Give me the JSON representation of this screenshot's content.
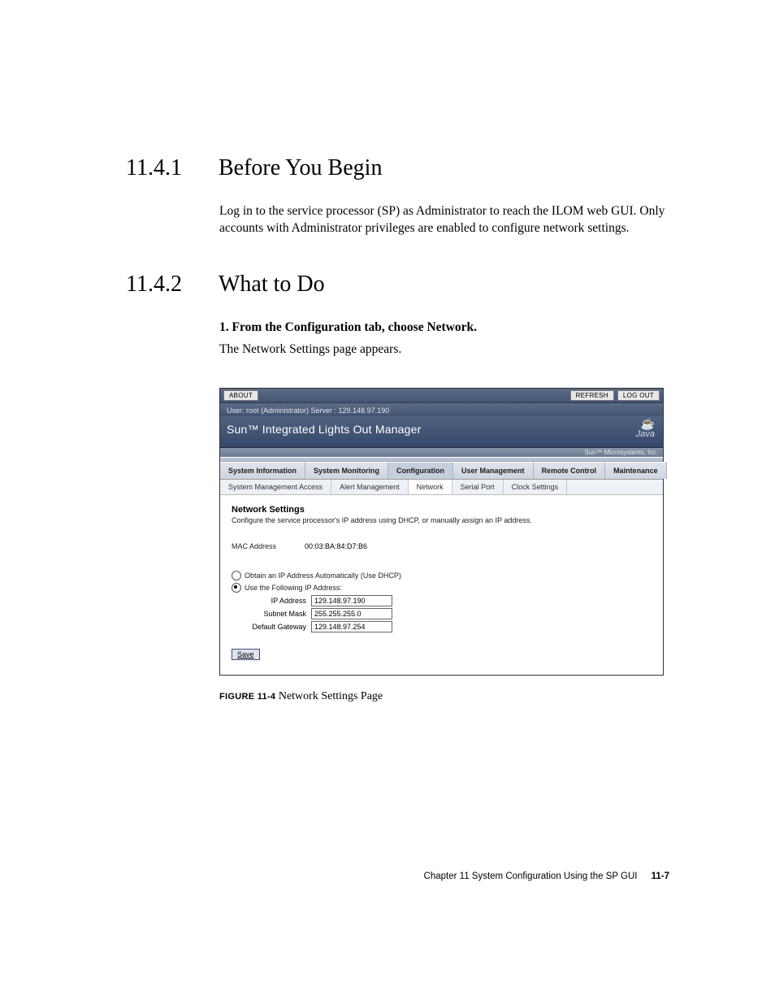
{
  "section1": {
    "num": "11.4.1",
    "title": "Before You Begin"
  },
  "para1": "Log in to the service processor (SP) as Administrator to reach the ILOM web GUI. Only accounts with Administrator privileges are enabled to configure network settings.",
  "section2": {
    "num": "11.4.2",
    "title": "What to Do"
  },
  "step1_bold": "1. From the Configuration tab, choose Network.",
  "step1_text": "The Network Settings page appears.",
  "screenshot": {
    "about": "ABOUT",
    "refresh": "REFRESH",
    "logout": "LOG OUT",
    "userline": "User: root (Administrator)   Server : 129.148.97.190",
    "title": "Sun™ Integrated Lights Out Manager",
    "java": "Java",
    "attribution": "Sun™ Microsystems, Inc.",
    "tabs": [
      "System Information",
      "System Monitoring",
      "Configuration",
      "User Management",
      "Remote Control",
      "Maintenance"
    ],
    "subtabs": [
      "System Management Access",
      "Alert Management",
      "Network",
      "Serial Port",
      "Clock Settings"
    ],
    "panel_title": "Network Settings",
    "panel_sub": "Configure the service processor's IP address using DHCP, or manually assign an IP address.",
    "mac_label": "MAC Address",
    "mac_value": "00:03:BA:84:D7:B6",
    "radio_dhcp": "Obtain an IP Address Automatically (Use DHCP)",
    "radio_static": "Use the Following IP Address:",
    "ip_label": "IP Address",
    "ip_value": "129.148.97.190",
    "mask_label": "Subnet Mask",
    "mask_value": "255.255.255.0",
    "gw_label": "Default Gateway",
    "gw_value": "129.148.97.254",
    "save": "Save"
  },
  "figure": {
    "label": "FIGURE 11-4",
    "caption": " Network Settings Page"
  },
  "footer": {
    "chapter": "Chapter 11    System Configuration Using the SP GUI",
    "page": "11-7"
  }
}
